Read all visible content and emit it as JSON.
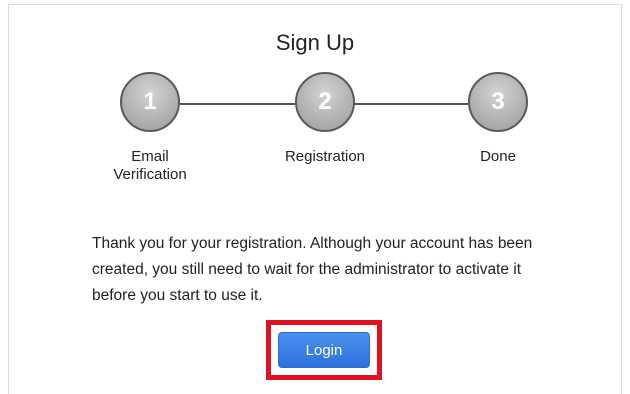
{
  "page": {
    "title": "Sign Up"
  },
  "steps": [
    {
      "number": "1",
      "label": "Email\nVerification"
    },
    {
      "number": "2",
      "label": "Registration"
    },
    {
      "number": "3",
      "label": "Done"
    }
  ],
  "message": "Thank you for your registration. Although your account has been created, you still need to wait for the administrator to activate it before you start to use it.",
  "actions": {
    "login_label": "Login"
  },
  "colors": {
    "button": "#2d72dc",
    "highlight": "#e01220",
    "step_circle": "#b3b3b3"
  }
}
